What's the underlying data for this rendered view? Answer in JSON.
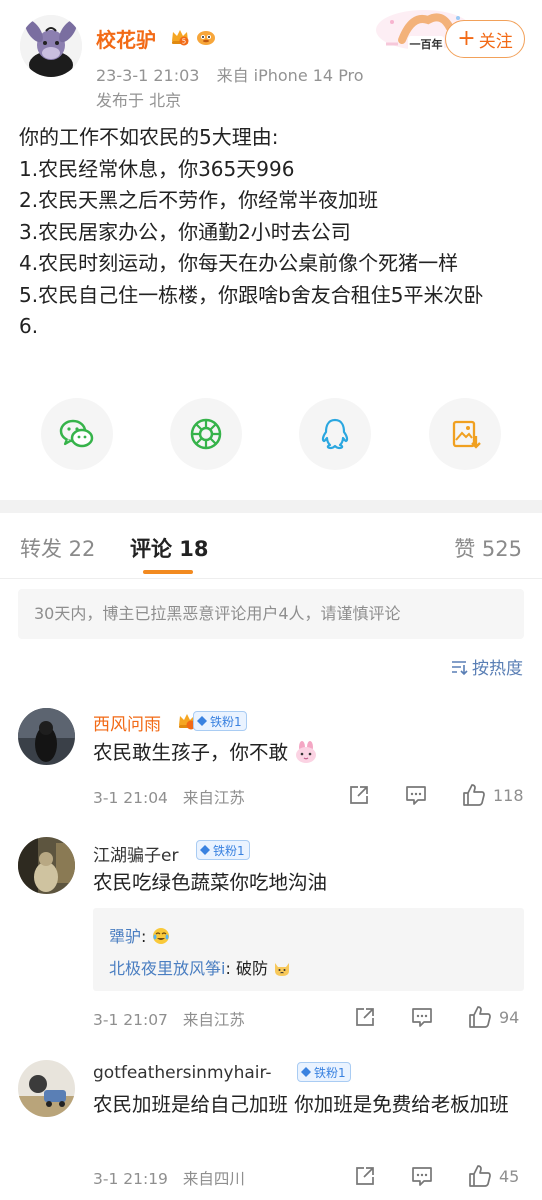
{
  "post": {
    "username": "校花驴",
    "timestamp": "23-3-1 21:03",
    "source": "来自 iPhone 14 Pro",
    "location": "发布于 北京",
    "follow_label": "关注",
    "sticker_text": "一百年",
    "lines": [
      "你的工作不如农民的5大理由:",
      "1.农民经常休息，你365天996",
      "2.农民天黑之后不劳作，你经常半夜加班",
      "3.农民居家办公，你通勤2小时去公司",
      "4.农民时刻运动，你每天在办公桌前像个死猪一样",
      "5.农民自己住一栋楼，你跟啥b舍友合租住5平米次卧",
      "6."
    ]
  },
  "share_icons": [
    "wechat-icon",
    "moments-icon",
    "qq-icon",
    "save-image-icon"
  ],
  "tabs": {
    "repost": "转发 22",
    "comments": "评论 18",
    "likes": "赞 525"
  },
  "notice": "30天内，博主已拉黑恶意评论用户4人，请谨慎评论",
  "sort_label": "按热度",
  "comments": [
    {
      "name": "西风问雨",
      "fan_badge": "铁粉1",
      "text": "农民敢生孩子，你不敢",
      "time": "3-1 21:04",
      "from": "来自江苏",
      "likes": "118"
    },
    {
      "name": "江湖骗子er",
      "fan_badge": "铁粉1",
      "text": "农民吃绿色蔬菜你吃地沟油",
      "replies": [
        {
          "name": "犟驴",
          "text": ""
        },
        {
          "name": "北极夜里放风筝i",
          "text": "破防"
        }
      ],
      "time": "3-1 21:07",
      "from": "来自江苏",
      "likes": "94"
    },
    {
      "name": "gotfeathersinmyhair-",
      "fan_badge": "铁粉1",
      "text": "农民加班是给自己加班 你加班是免费给老板加班",
      "time": "3-1 21:19",
      "from": "来自四川",
      "likes": "45"
    }
  ],
  "colors": {
    "accent": "#f26a16",
    "link": "#4a7ec1",
    "meta": "#939393",
    "tab_underline": "#f28a20"
  }
}
